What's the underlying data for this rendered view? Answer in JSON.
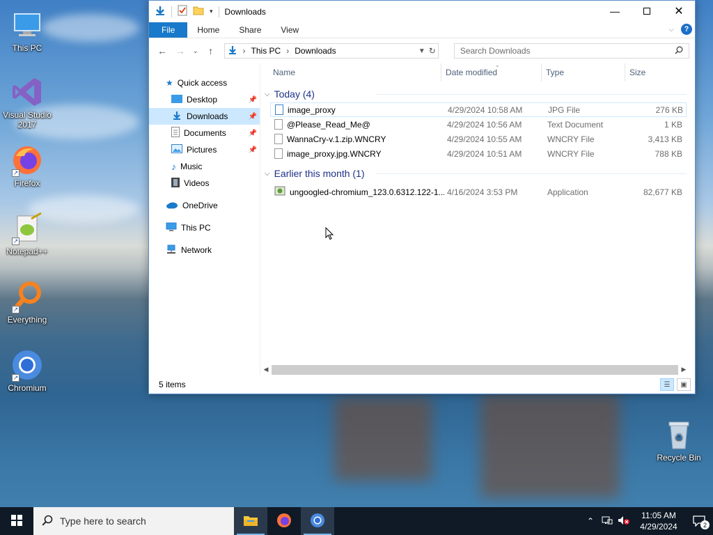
{
  "desktop": {
    "icons": [
      {
        "label": "This PC"
      },
      {
        "label": "Visual Studio 2017"
      },
      {
        "label": "Firefox"
      },
      {
        "label": "Notepad++"
      },
      {
        "label": "Everything"
      },
      {
        "label": "Chromium"
      },
      {
        "label": "Recycle Bin"
      }
    ]
  },
  "window": {
    "title": "Downloads",
    "ribbon_tabs": [
      "File",
      "Home",
      "Share",
      "View"
    ],
    "help_label": "?",
    "breadcrumb": [
      "This PC",
      "Downloads"
    ],
    "search_placeholder": "Search Downloads",
    "nav": {
      "quick_access": "Quick access",
      "desktop": "Desktop",
      "downloads": "Downloads",
      "documents": "Documents",
      "pictures": "Pictures",
      "music": "Music",
      "videos": "Videos",
      "onedrive": "OneDrive",
      "this_pc": "This PC",
      "network": "Network"
    },
    "columns": {
      "name": "Name",
      "date": "Date modified",
      "type": "Type",
      "size": "Size"
    },
    "groups": [
      {
        "label": "Today (4)",
        "files": [
          {
            "name": "image_proxy",
            "date": "4/29/2024 10:58 AM",
            "type": "JPG File",
            "size": "276 KB"
          },
          {
            "name": "@Please_Read_Me@",
            "date": "4/29/2024 10:56 AM",
            "type": "Text Document",
            "size": "1 KB"
          },
          {
            "name": "WannaCry-v.1.zip.WNCRY",
            "date": "4/29/2024 10:55 AM",
            "type": "WNCRY File",
            "size": "3,413 KB"
          },
          {
            "name": "image_proxy.jpg.WNCRY",
            "date": "4/29/2024 10:51 AM",
            "type": "WNCRY File",
            "size": "788 KB"
          }
        ]
      },
      {
        "label": "Earlier this month (1)",
        "files": [
          {
            "name": "ungoogled-chromium_123.0.6312.122-1....",
            "date": "4/16/2024 3:53 PM",
            "type": "Application",
            "size": "82,677 KB"
          }
        ]
      }
    ],
    "status": "5 items"
  },
  "taskbar": {
    "search_placeholder": "Type here to search",
    "time": "11:05 AM",
    "date": "4/29/2024",
    "notification_count": "2"
  },
  "colors": {
    "accent": "#1979ca",
    "selection": "#cce8ff",
    "group_text": "#1e3287",
    "taskbar": "#0f1a26"
  }
}
